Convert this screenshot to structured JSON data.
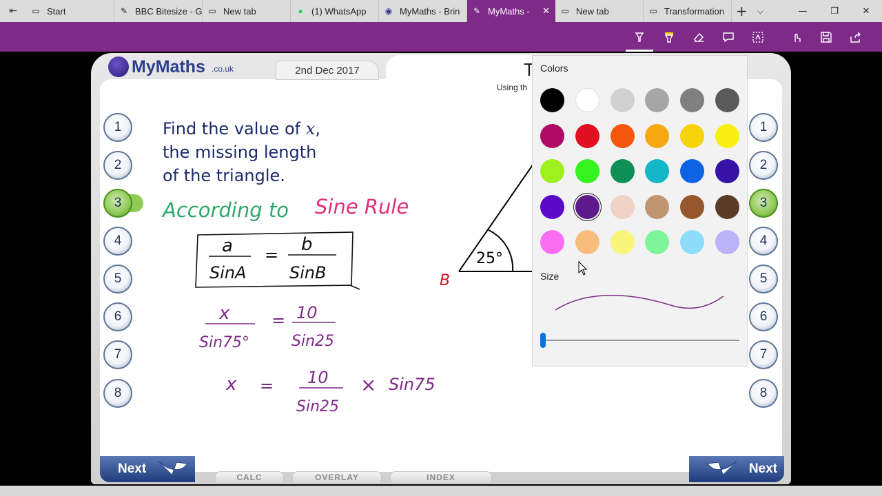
{
  "tabs": [
    {
      "label": "Start",
      "icon": "window-icon"
    },
    {
      "label": "BBC Bitesize - G",
      "icon": "pen-icon"
    },
    {
      "label": "New tab",
      "icon": "window-icon"
    },
    {
      "label": "(1) WhatsApp",
      "icon": "whatsapp-icon"
    },
    {
      "label": "MyMaths - Brin",
      "icon": "mymaths-icon"
    },
    {
      "label": "MyMaths -",
      "icon": "pen-icon",
      "active": true
    },
    {
      "label": "New tab",
      "icon": "window-icon"
    },
    {
      "label": "Transformation",
      "icon": "window-icon"
    }
  ],
  "page": {
    "logo": "MyMaths",
    "logo_suffix": ".co.uk",
    "date": "2nd Dec 2017",
    "title_partial": "T",
    "subtitle_partial": "Using th",
    "question_lines": [
      "Find the value of ",
      "x",
      ",",
      "the missing length",
      "of the triangle."
    ],
    "question_buttons_left": [
      "1",
      "2",
      "3",
      "4",
      "5",
      "6",
      "7",
      "8"
    ],
    "question_buttons_right": [
      "1",
      "2",
      "3",
      "4",
      "5",
      "6",
      "7",
      "8"
    ],
    "active_question": "3",
    "triangle_angle": "25°",
    "vertex_label": "B",
    "handwriting": {
      "heading_green": "According to",
      "heading_pink": "Sine Rule",
      "rule_a": "a",
      "rule_sinA": "SinA",
      "rule_equals": "=",
      "rule_b": "b",
      "rule_sinB": "SinB",
      "eq1_x": "x",
      "eq1_sin75": "Sin75°",
      "eq1_10": "10",
      "eq1_sin25": "Sin25",
      "eq2_x": "x",
      "eq2_10": "10",
      "eq2_sin25": "Sin25",
      "eq2_times": "×",
      "eq2_sin75": "Sin75"
    },
    "next_label": "Next",
    "bottom_tabs": [
      "CALC",
      "OVERLAY",
      "INDEX"
    ]
  },
  "picker": {
    "colors_label": "Colors",
    "size_label": "Size",
    "colors": [
      [
        "#000000",
        "#ffffff",
        "#d1d1d1",
        "#a6a6a6",
        "#808080",
        "#5a5a5a"
      ],
      [
        "#ad0b66",
        "#e01022",
        "#f7560d",
        "#f7a70f",
        "#f7d30a",
        "#f7f012"
      ],
      [
        "#9ef01f",
        "#36f21e",
        "#0e8f55",
        "#14b7c7",
        "#0e63e5",
        "#3612a6"
      ],
      [
        "#5b08c9",
        "#5d1a8a",
        "#f1d3c6",
        "#bf9670",
        "#96572c",
        "#5c3a2a"
      ],
      [
        "#fb6df2",
        "#f8bd7d",
        "#f8f57a",
        "#7ff59a",
        "#8cdcfa",
        "#bcb2f8"
      ]
    ],
    "selected": [
      3,
      1
    ],
    "stroke_color": "#7e2a87"
  }
}
